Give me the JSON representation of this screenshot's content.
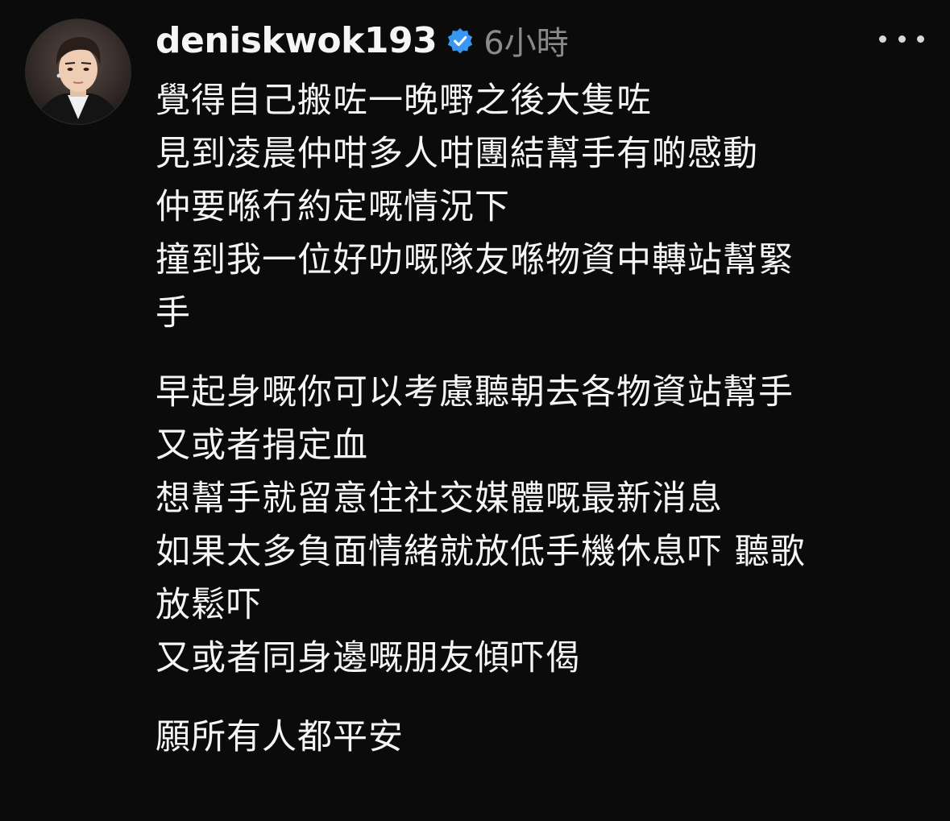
{
  "post": {
    "username": "deniskwok193",
    "verified": true,
    "timestamp": "6小時",
    "avatar_icon": "profile-photo",
    "more_icon": "ellipsis-horizontal-icon",
    "accent_color": "#3897f0",
    "caption": {
      "paragraph1": [
        "覺得自己搬咗一晚嘢之後大隻咗",
        "見到凌晨仲咁多人咁團結幫手有啲感動",
        "仲要喺冇約定嘅情況下",
        "撞到我一位好叻嘅隊友喺物資中轉站幫緊",
        "手"
      ],
      "paragraph2": [
        "早起身嘅你可以考慮聽朝去各物資站幫手",
        "又或者捐定血",
        "想幫手就留意住社交媒體嘅最新消息",
        "如果太多負面情緒就放低手機休息吓 聽歌",
        "放鬆吓",
        "又或者同身邊嘅朋友傾吓偈"
      ],
      "paragraph3": [
        "願所有人都平安"
      ]
    }
  }
}
